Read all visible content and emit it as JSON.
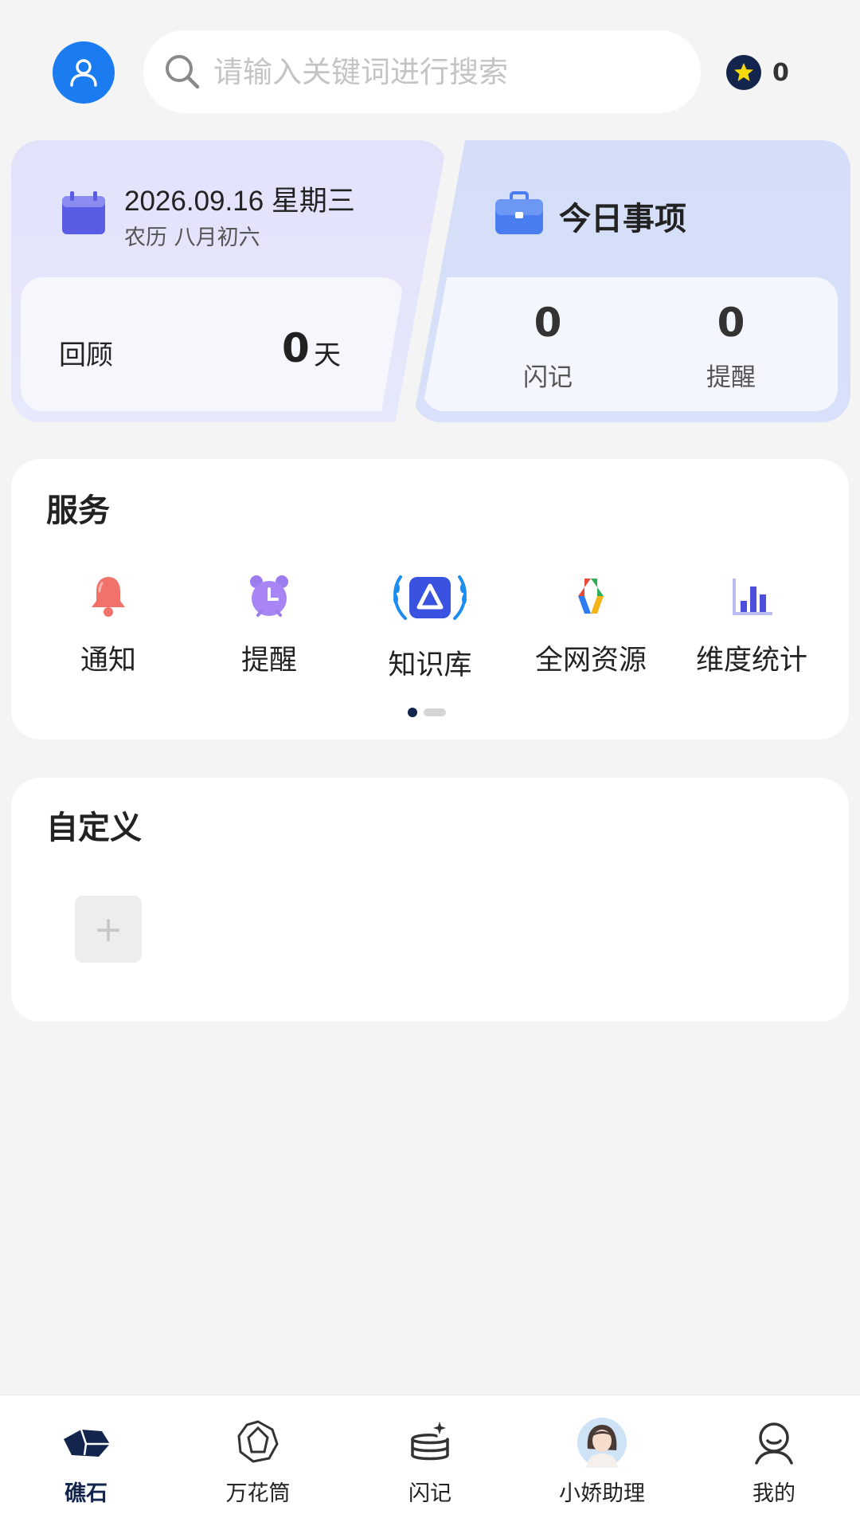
{
  "header": {
    "search_placeholder": "请输入关键词进行搜索",
    "points": "0"
  },
  "date_card": {
    "date": "2026.09.16 星期三",
    "lunar": "农历 八月初六",
    "review_label": "回顾",
    "review_value": "0",
    "review_unit": "天"
  },
  "today_card": {
    "title": "今日事项",
    "stats": [
      {
        "value": "0",
        "label": "闪记"
      },
      {
        "value": "0",
        "label": "提醒"
      }
    ]
  },
  "services": {
    "title": "服务",
    "items": [
      {
        "label": "通知",
        "icon": "bell-icon"
      },
      {
        "label": "提醒",
        "icon": "alarm-clock-icon"
      },
      {
        "label": "知识库",
        "icon": "knowledge-base-icon"
      },
      {
        "label": "全网资源",
        "icon": "web-resources-icon"
      },
      {
        "label": "维度统计",
        "icon": "bar-chart-icon"
      }
    ],
    "page_indicator": {
      "current": 1,
      "total": 2
    }
  },
  "custom": {
    "title": "自定义",
    "add_label": "+"
  },
  "bottom_nav": {
    "items": [
      {
        "label": "礁石",
        "icon": "rock-icon",
        "active": true
      },
      {
        "label": "万花筒",
        "icon": "kaleidoscope-icon",
        "active": false
      },
      {
        "label": "闪记",
        "icon": "flash-note-icon",
        "active": false
      },
      {
        "label": "小娇助理",
        "icon": "assistant-avatar-icon",
        "active": false
      },
      {
        "label": "我的",
        "icon": "profile-icon",
        "active": false
      }
    ]
  },
  "colors": {
    "accent_blue": "#1a7cf0",
    "navy": "#13254d",
    "background": "#f4f4f4"
  }
}
